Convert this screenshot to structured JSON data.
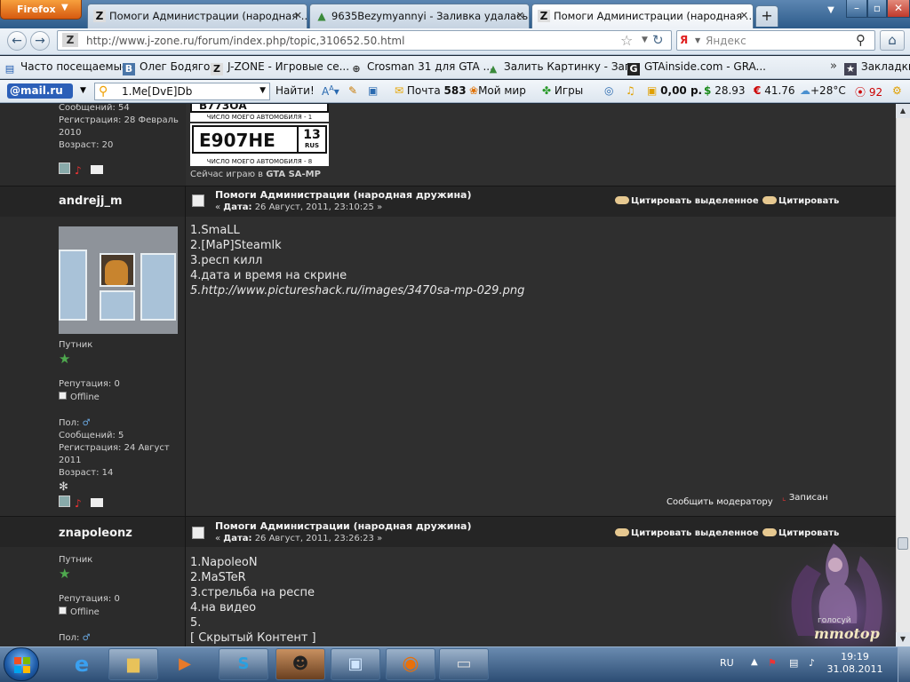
{
  "browser": {
    "firefox_button": "Firefox",
    "tabs": [
      {
        "icon": "zone-favicon",
        "label": "Помоги Администрации (народная ...",
        "active": false
      },
      {
        "icon": "image-favicon",
        "label": "9635Bezymyannyi - Заливка удалась...",
        "active": false
      },
      {
        "icon": "zone-favicon",
        "label": "Помоги Администрации (народная ...",
        "active": true
      }
    ],
    "new_tab": "+",
    "url": "http://www.j-zone.ru/forum/index.php/topic,310652.50.html",
    "search_placeholder": "Яндекс",
    "search_engine_icon": "Я"
  },
  "bookmarks": {
    "items": [
      {
        "icon": "firefox-folder-icon",
        "label": "Часто посещаемые"
      },
      {
        "icon": "vk-icon",
        "label": "Олег Бодягов"
      },
      {
        "icon": "zone-favicon",
        "label": "J-ZONE - Игровые се..."
      },
      {
        "icon": "crosman-icon",
        "label": "Crosman 31 для GTA ..."
      },
      {
        "icon": "image-favicon",
        "label": "Залить Картинку - Заг..."
      },
      {
        "icon": "gtainside-icon",
        "label": "GTAinside.com - GRA..."
      }
    ],
    "more": "»",
    "bookmarks_menu": "Закладки"
  },
  "mailbar": {
    "logo": "@mail.ru",
    "search_value": "1.Me[DvE]Db",
    "find_button": "Найти!",
    "mail_label": "Почта",
    "mail_count": "583",
    "my_world": "Мой мир",
    "games": "Игры",
    "balance": "0,00 р.",
    "usd": "28.93",
    "eur": "41.76",
    "weather": "+28°C",
    "traffic": "92"
  },
  "forum": {
    "prev_user": {
      "messages": "Сообщений: 54",
      "registration": "Регистрация: 28 Февраль 2010",
      "age": "Возраст: 20",
      "plate_top": "В773ОА",
      "plate_caption1": "ЧИСЛО МОЕГО АВТОМОБИЛЯ - 1",
      "plate_main": "Е907НЕ",
      "plate_region": "13",
      "plate_rus": "RUS",
      "plate_caption2": "ЧИСЛО МОЕГО АВТОМОБИЛЯ - 8",
      "now_playing_prefix": "Сейчас играю в",
      "now_playing_game": "GTA SA-MP"
    },
    "posts": [
      {
        "username": "andrejj_m",
        "title": "Помоги Администрации (народная дружина)",
        "date_label": "Дата:",
        "date_value": "26 Август, 2011, 23:10:25 »",
        "quote_selected": "Цитировать выделенное",
        "quote": "Цитировать",
        "lines": [
          "1.SmaLL",
          "2.[MaP]Steamlk",
          "3.респ килл",
          "4.дата и время на скрине",
          "5.http://www.pictureshack.ru/images/3470sa-mp-029.png"
        ],
        "rank": "Путник",
        "reputation": "Репутация: 0",
        "status": "Offline",
        "gender": "Пол:",
        "messages": "Сообщений: 5",
        "registration": "Регистрация: 24 Август 2011",
        "age": "Возраст: 14",
        "report": "Сообщить модератору",
        "logged": "Записан"
      },
      {
        "username": "znapoleonz",
        "title": "Помоги Администрации (народная дружина)",
        "date_label": "Дата:",
        "date_value": "26 Август, 2011, 23:26:23 »",
        "quote_selected": "Цитировать выделенное",
        "quote": "Цитировать",
        "lines": [
          "1.NapoleoN",
          "2.MaSTeR",
          "3.стрельба на респе",
          "4.на видео",
          "5."
        ],
        "hidden": "[ Скрытый Контент ]",
        "rank": "Путник",
        "reputation": "Репутация: 0",
        "status": "Offline",
        "gender": "Пол:"
      }
    ],
    "banner_caption": "голосуй",
    "banner_brand": "mmotop"
  },
  "taskbar": {
    "lang": "RU",
    "time": "19:19",
    "date": "31.08.2011"
  },
  "colors": {
    "page_bg": "#2a2a2a",
    "header_bg": "#252525",
    "text": "#e6e6e6",
    "accent_star": "#4ea94e"
  }
}
